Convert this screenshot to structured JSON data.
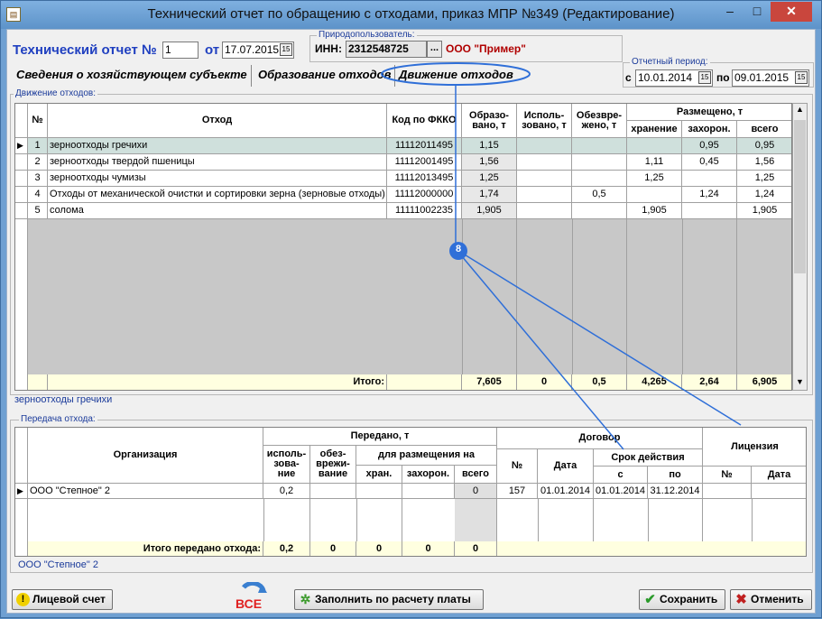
{
  "window": {
    "title": "Технический отчет по обращению с отходами, приказ МПР №349 (Редактирование)",
    "minimize": "–",
    "maximize": "□",
    "close": "✕"
  },
  "header": {
    "report_label": "Технический отчет №",
    "report_number": "1",
    "from_label": "от",
    "report_date": "17.07.2015",
    "user_group_title": "Природопользователь:",
    "inn_label": "ИНН:",
    "inn_value": "2312548725",
    "inn_button": "...",
    "org_name": "ООО \"Пример\""
  },
  "tabs": [
    {
      "label": "Сведения о хозяйствующем субъекте"
    },
    {
      "label": "Образование отходов"
    },
    {
      "label": "Движение отходов"
    }
  ],
  "period": {
    "title": "Отчетный период:",
    "from_label": "с",
    "from_value": "10.01.2014",
    "to_label": "по",
    "to_value": "09.01.2015"
  },
  "movement": {
    "group_title": "Движение отходов:",
    "columns": {
      "num": "№",
      "waste": "Отход",
      "fkko": "Код по ФККО",
      "formed": "Образо-вано, т",
      "used": "Исполь-зовано, т",
      "neutralized": "Обезвре-жено, т",
      "placed": "Размещено, т",
      "storage": "хранение",
      "burial": "захорон.",
      "total": "всего"
    },
    "rows": [
      {
        "num": "1",
        "waste": "зерноотходы гречихи",
        "fkko": "11112011495",
        "formed": "1,15",
        "used": "",
        "neutralized": "",
        "storage": "",
        "burial": "0,95",
        "total": "0,95"
      },
      {
        "num": "2",
        "waste": "зерноотходы твердой пшеницы",
        "fkko": "11112001495",
        "formed": "1,56",
        "used": "",
        "neutralized": "",
        "storage": "1,11",
        "burial": "0,45",
        "total": "1,56"
      },
      {
        "num": "3",
        "waste": "зерноотходы чумизы",
        "fkko": "11112013495",
        "formed": "1,25",
        "used": "",
        "neutralized": "",
        "storage": "1,25",
        "burial": "",
        "total": "1,25"
      },
      {
        "num": "4",
        "waste": "Отходы от механической очистки и сортировки зерна (зерновые отходы)",
        "fkko": "11112000000",
        "formed": "1,74",
        "used": "",
        "neutralized": "0,5",
        "storage": "",
        "burial": "1,24",
        "total": "1,24"
      },
      {
        "num": "5",
        "waste": "солома",
        "fkko": "11111002235",
        "formed": "1,905",
        "used": "",
        "neutralized": "",
        "storage": "1,905",
        "burial": "",
        "total": "1,905"
      }
    ],
    "totals": {
      "label": "Итого:",
      "formed": "7,605",
      "used": "0",
      "neutralized": "0,5",
      "storage": "4,265",
      "burial": "2,64",
      "total": "6,905"
    },
    "selected_caption": "зерноотходы гречихи"
  },
  "transfer": {
    "group_title": "Передача отхода:",
    "columns": {
      "org": "Организация",
      "transferred": "Передано, т",
      "use": "исполь-зова-ние",
      "neutral": "обез-врежи-вание",
      "for_placement": "для размещения на",
      "storage": "хран.",
      "burial": "захорон.",
      "total": "всего",
      "contract": "Договор",
      "contract_num": "№",
      "contract_date": "Дата",
      "validity": "Срок действия",
      "valid_from": "с",
      "valid_to": "по",
      "license": "Лицензия",
      "license_num": "№",
      "license_date": "Дата"
    },
    "rows": [
      {
        "org": "ООО \"Степное\" 2",
        "use": "0,2",
        "neutral": "",
        "storage": "",
        "burial": "",
        "total": "0",
        "contract_num": "157",
        "contract_date": "01.01.2014",
        "valid_from": "01.01.2014",
        "valid_to": "31.12.2014",
        "license_num": "",
        "license_date": ""
      }
    ],
    "totals": {
      "label": "Итого передано отхода:",
      "use": "0,2",
      "neutral": "0",
      "storage": "0",
      "burial": "0",
      "total": "0"
    },
    "selected_caption": "ООО \"Степное\" 2"
  },
  "callout": {
    "number": "8"
  },
  "footer": {
    "account_button": "Лицевой счет",
    "all_button": "ВСЕ",
    "fill_button": "Заполнить по расчету платы",
    "save_button": "Сохранить",
    "cancel_button": "Отменить"
  },
  "colors": {
    "title_bar": "#6fa0d2",
    "accent_blue": "#2040c0",
    "org_red": "#b00000",
    "totals_bg": "#ffffe0",
    "selected_row": "#cfe0dc",
    "callout": "#2f6fd8"
  }
}
